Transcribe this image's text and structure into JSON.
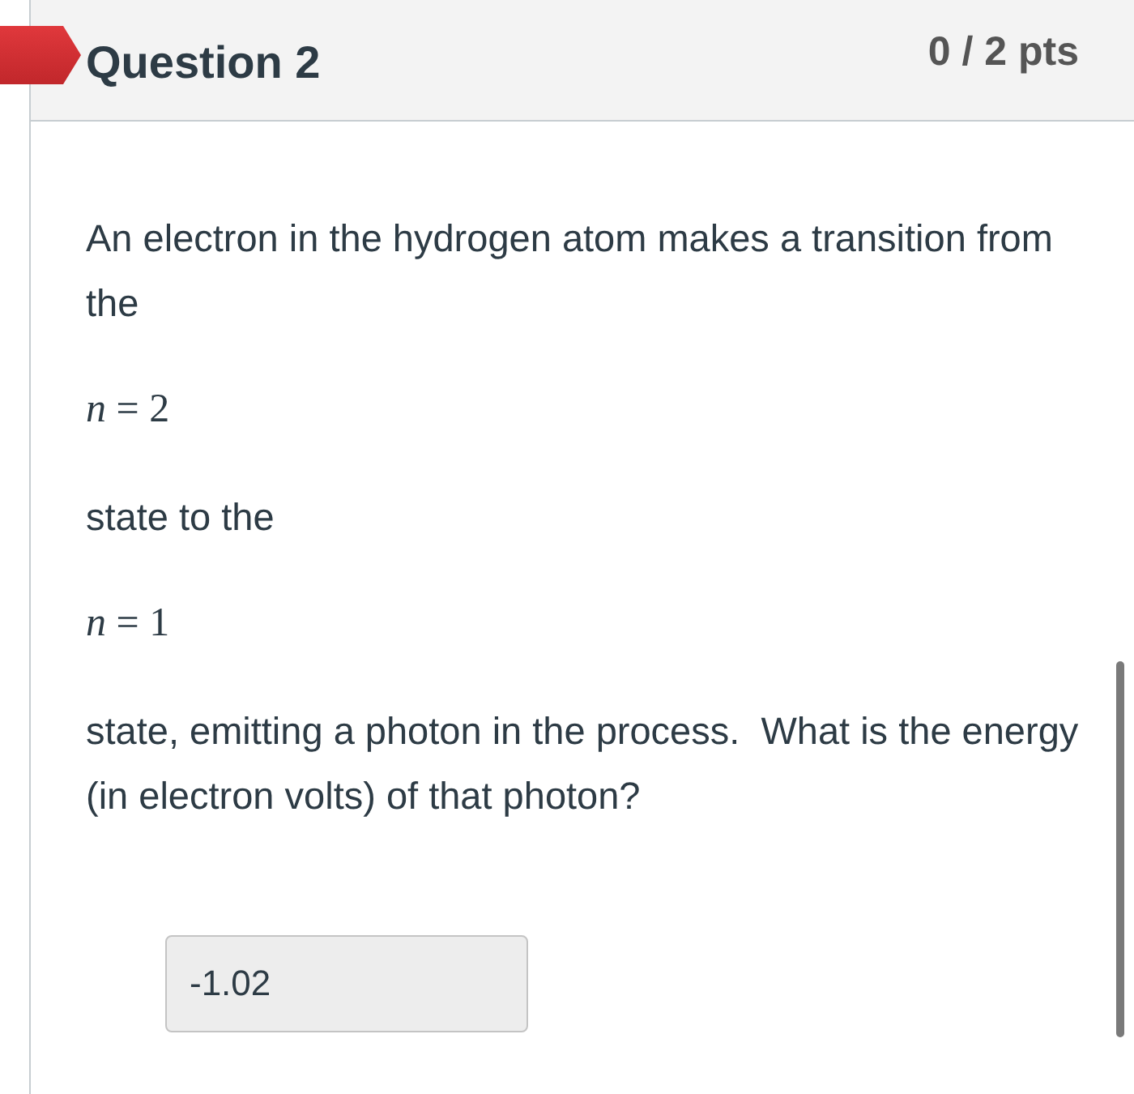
{
  "question": {
    "title": "Question 2",
    "points": "0 / 2 pts",
    "incorrect": true,
    "body": [
      {
        "kind": "text",
        "text": "An electron in the hydrogen atom makes a transition from the"
      },
      {
        "kind": "math",
        "text": "*n* = 2"
      },
      {
        "kind": "text",
        "text": "state to the"
      },
      {
        "kind": "math",
        "text": "*n* = 1"
      },
      {
        "kind": "text",
        "text": "state, emitting a photon in the process.  What is the energy (in electron volts) of that photon?"
      }
    ],
    "answer": {
      "value": "-1.02"
    }
  }
}
